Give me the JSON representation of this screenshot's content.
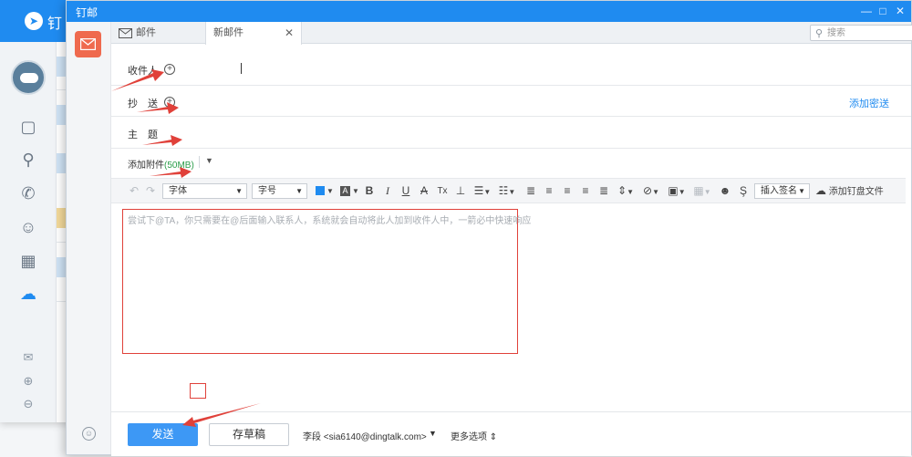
{
  "bg_app": {
    "title": "钉"
  },
  "window": {
    "title": "钉邮",
    "minimize": "—",
    "maximize": "□",
    "close": "✕"
  },
  "tabs": {
    "mail_label": "邮件",
    "new_mail_label": "新邮件",
    "close": "✕"
  },
  "search": {
    "placeholder": "搜索"
  },
  "more": "•••",
  "form": {
    "to_label": "收件人",
    "cc_label": "抄　送",
    "subject_label": "主　题",
    "add_bcc": "添加密送",
    "attach_label": "添加附件",
    "attach_size": "(50MB)",
    "attach_dropdown": "▼"
  },
  "toolbar": {
    "undo": "↶",
    "redo": "↷",
    "font_select": "字体",
    "size_select": "字号",
    "bold": "B",
    "italic": "I",
    "underline": "U",
    "strikethrough": "A",
    "clear_format": "Tx",
    "insert_signature": "插入签名",
    "add_drive_file": "添加钉盘文件"
  },
  "editor": {
    "placeholder": "尝试下@TA，你只需要在@后面输入联系人，系统就会自动将此人加到收件人中，一箭必中快速响应"
  },
  "bottom": {
    "send": "发送",
    "save_draft": "存草稿",
    "sender": "李段 <sia6140@dingtalk.com>",
    "sender_dropdown": "▼",
    "more_options": "更多选项 ⇕"
  },
  "colors": {
    "accent": "#1f8bf0",
    "send_button": "#3d98f5",
    "mail_icon": "#ef6a4e",
    "annotation": "#e0413a"
  }
}
